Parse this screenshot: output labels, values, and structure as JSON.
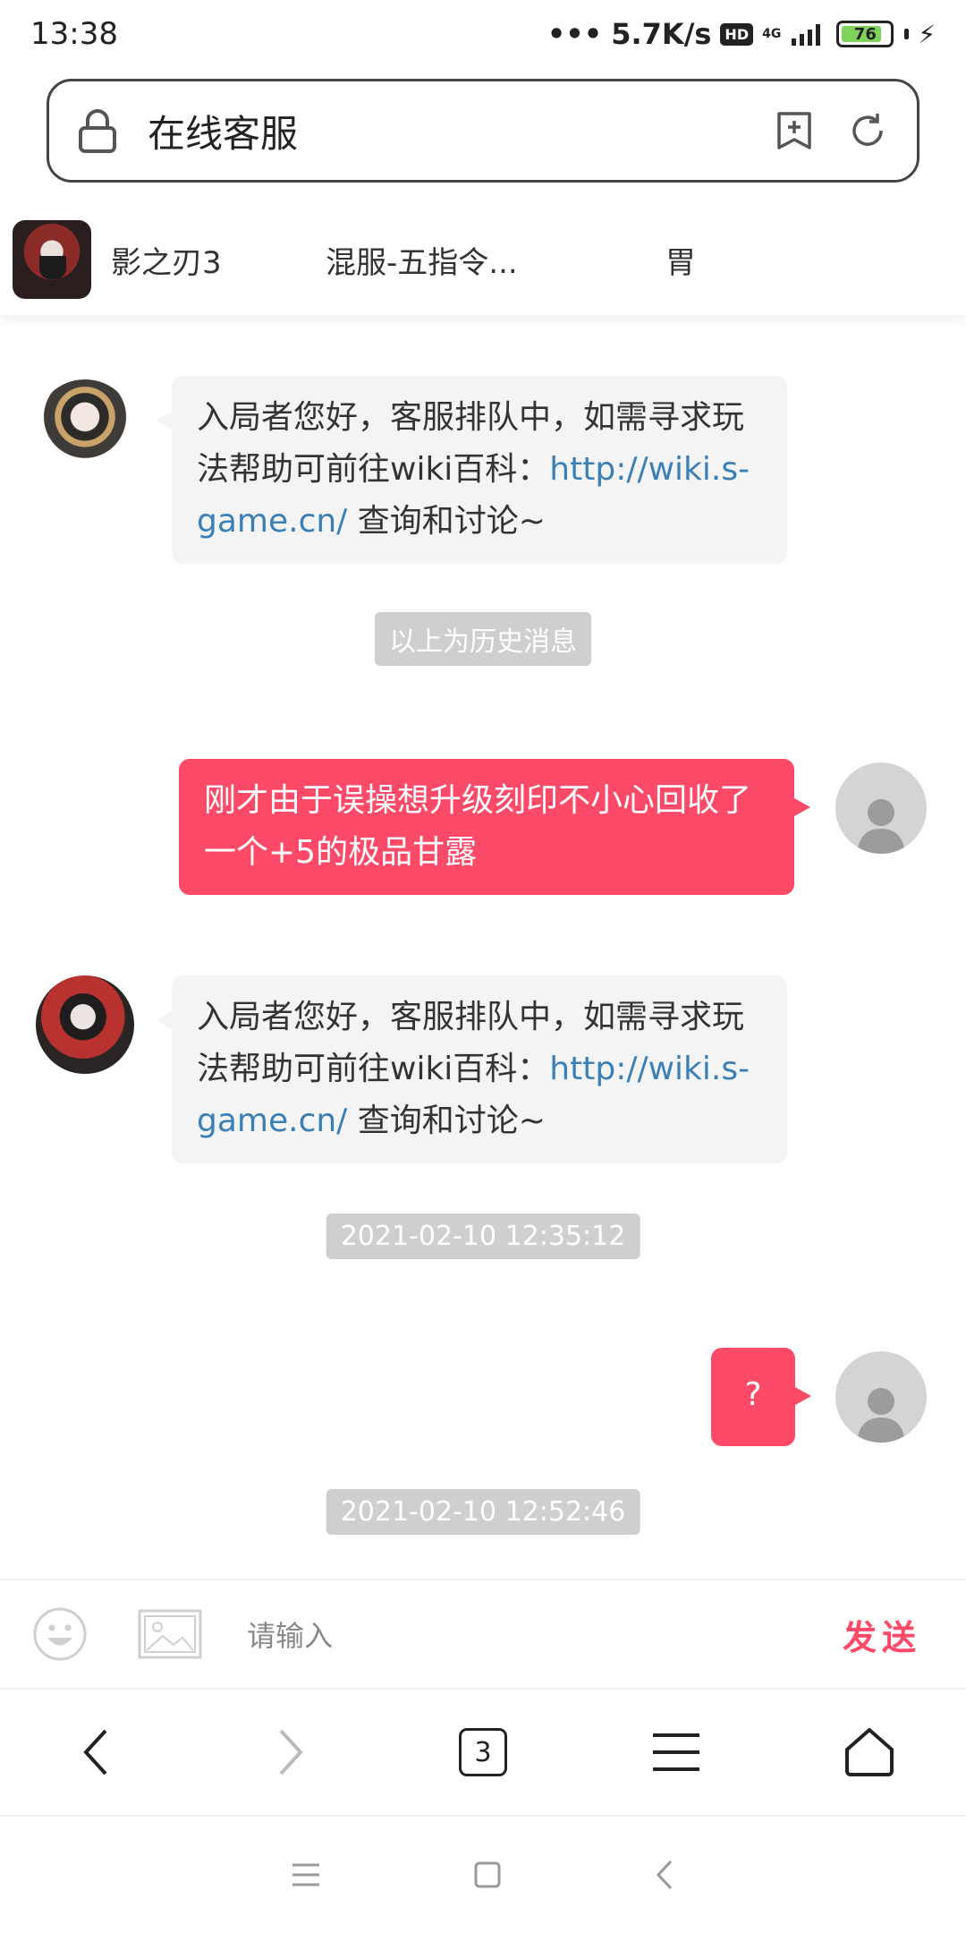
{
  "status_bar": {
    "time": "13:38",
    "net_speed": "5.7K/s",
    "hd_label": "HD",
    "network": "4G",
    "battery_level": "76"
  },
  "browser": {
    "page_title": "在线客服"
  },
  "game": {
    "name": "影之刃3",
    "server": "混服-五指令...",
    "role": "胃"
  },
  "messages": [
    {
      "sender": "agent",
      "text_before_link": "入局者您好，客服排队中，如需寻求玩法帮助可前往wiki百科：",
      "link": "http://wiki.s-game.cn/",
      "text_after_link": " 查询和讨论~"
    },
    {
      "divider": "以上为历史消息"
    },
    {
      "sender": "user",
      "text": "刚才由于误操想升级刻印不小心回收了一个+5的极品甘露"
    },
    {
      "sender": "agent",
      "text_before_link": "入局者您好，客服排队中，如需寻求玩法帮助可前往wiki百科：",
      "link": "http://wiki.s-game.cn/",
      "text_after_link": " 查询和讨论~"
    },
    {
      "timestamp": "2021-02-10 12:35:12"
    },
    {
      "sender": "user",
      "text": "?"
    },
    {
      "timestamp": "2021-02-10 12:52:46"
    }
  ],
  "input": {
    "placeholder": "请输入",
    "send_label": "发送"
  },
  "browser_nav": {
    "tab_count": "3"
  },
  "icons": {
    "lock": "lock-icon",
    "bookmark_add": "add-bookmark-icon",
    "refresh": "refresh-icon",
    "emoji": "emoji-icon",
    "image": "image-icon",
    "back": "back-arrow-icon",
    "forward": "forward-arrow-icon",
    "menu": "menu-icon",
    "home": "home-icon"
  },
  "colors": {
    "accent": "#fc4a68",
    "link": "#3a7fb6",
    "agent_bubble": "#f4f4f4",
    "divider_tag": "#cfcfcf"
  }
}
